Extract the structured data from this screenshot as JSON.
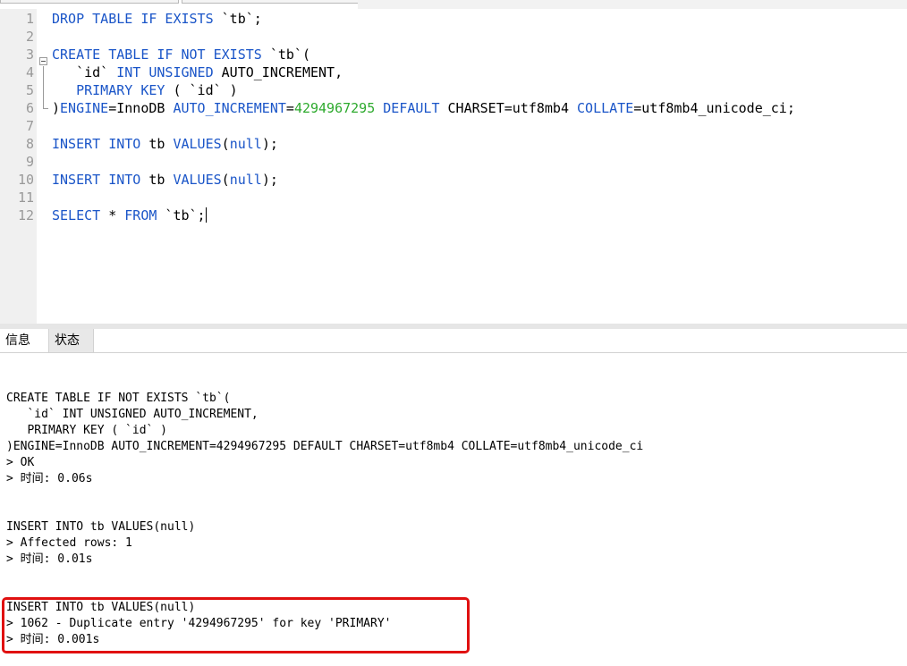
{
  "editor": {
    "lines": [
      {
        "n": "1",
        "parts": [
          {
            "t": "DROP TABLE IF EXISTS",
            "k": "kw"
          },
          {
            "t": " `tb`;",
            "k": ""
          }
        ]
      },
      {
        "n": "2",
        "parts": []
      },
      {
        "n": "3",
        "parts": [
          {
            "t": "CREATE TABLE IF NOT EXISTS",
            "k": "kw"
          },
          {
            "t": " `tb`(",
            "k": ""
          }
        ]
      },
      {
        "n": "4",
        "parts": [
          {
            "t": "   `id` ",
            "k": ""
          },
          {
            "t": "INT UNSIGNED",
            "k": "kw"
          },
          {
            "t": " AUTO_INCREMENT,",
            "k": ""
          }
        ]
      },
      {
        "n": "5",
        "parts": [
          {
            "t": "   PRIMARY KEY",
            "k": "kw"
          },
          {
            "t": " ( `id` )",
            "k": ""
          }
        ]
      },
      {
        "n": "6",
        "parts": [
          {
            "t": ")",
            "k": ""
          },
          {
            "t": "ENGINE",
            "k": "kw"
          },
          {
            "t": "=InnoDB ",
            "k": ""
          },
          {
            "t": "AUTO_INCREMENT",
            "k": "kw"
          },
          {
            "t": "=",
            "k": ""
          },
          {
            "t": "4294967295",
            "k": "num"
          },
          {
            "t": " ",
            "k": ""
          },
          {
            "t": "DEFAULT",
            "k": "kw"
          },
          {
            "t": " CHARSET=utf8mb4 ",
            "k": ""
          },
          {
            "t": "COLLATE",
            "k": "kw"
          },
          {
            "t": "=utf8mb4_unicode_ci;",
            "k": ""
          }
        ]
      },
      {
        "n": "7",
        "parts": []
      },
      {
        "n": "8",
        "parts": [
          {
            "t": "INSERT INTO",
            "k": "kw"
          },
          {
            "t": " tb ",
            "k": ""
          },
          {
            "t": "VALUES",
            "k": "kw"
          },
          {
            "t": "(",
            "k": ""
          },
          {
            "t": "null",
            "k": "kw"
          },
          {
            "t": ");",
            "k": ""
          }
        ]
      },
      {
        "n": "9",
        "parts": []
      },
      {
        "n": "10",
        "parts": [
          {
            "t": "INSERT INTO",
            "k": "kw"
          },
          {
            "t": " tb ",
            "k": ""
          },
          {
            "t": "VALUES",
            "k": "kw"
          },
          {
            "t": "(",
            "k": ""
          },
          {
            "t": "null",
            "k": "kw"
          },
          {
            "t": ");",
            "k": ""
          }
        ]
      },
      {
        "n": "11",
        "parts": []
      },
      {
        "n": "12",
        "parts": [
          {
            "t": "SELECT",
            "k": "kw"
          },
          {
            "t": " * ",
            "k": ""
          },
          {
            "t": "FROM",
            "k": "kw"
          },
          {
            "t": " `tb`;",
            "k": ""
          }
        ]
      }
    ]
  },
  "tabs": {
    "info": "信息",
    "status": "状态"
  },
  "output": {
    "block1": {
      "l1": "CREATE TABLE IF NOT EXISTS `tb`(",
      "l2": "   `id` INT UNSIGNED AUTO_INCREMENT,",
      "l3": "   PRIMARY KEY ( `id` )",
      "l4": ")ENGINE=InnoDB AUTO_INCREMENT=4294967295 DEFAULT CHARSET=utf8mb4 COLLATE=utf8mb4_unicode_ci",
      "l5": "> OK",
      "l6": "> 时间: 0.06s"
    },
    "block2": {
      "l1": "INSERT INTO tb VALUES(null)",
      "l2": "> Affected rows: 1",
      "l3": "> 时间: 0.01s"
    },
    "block3": {
      "l1": "INSERT INTO tb VALUES(null)",
      "l2": "> 1062 - Duplicate entry '4294967295' for key 'PRIMARY'",
      "l3": "> 时间: 0.001s"
    }
  },
  "colors": {
    "keyword": "#1a55c8",
    "number": "#2eaa2e",
    "highlight_box": "#e01010"
  }
}
